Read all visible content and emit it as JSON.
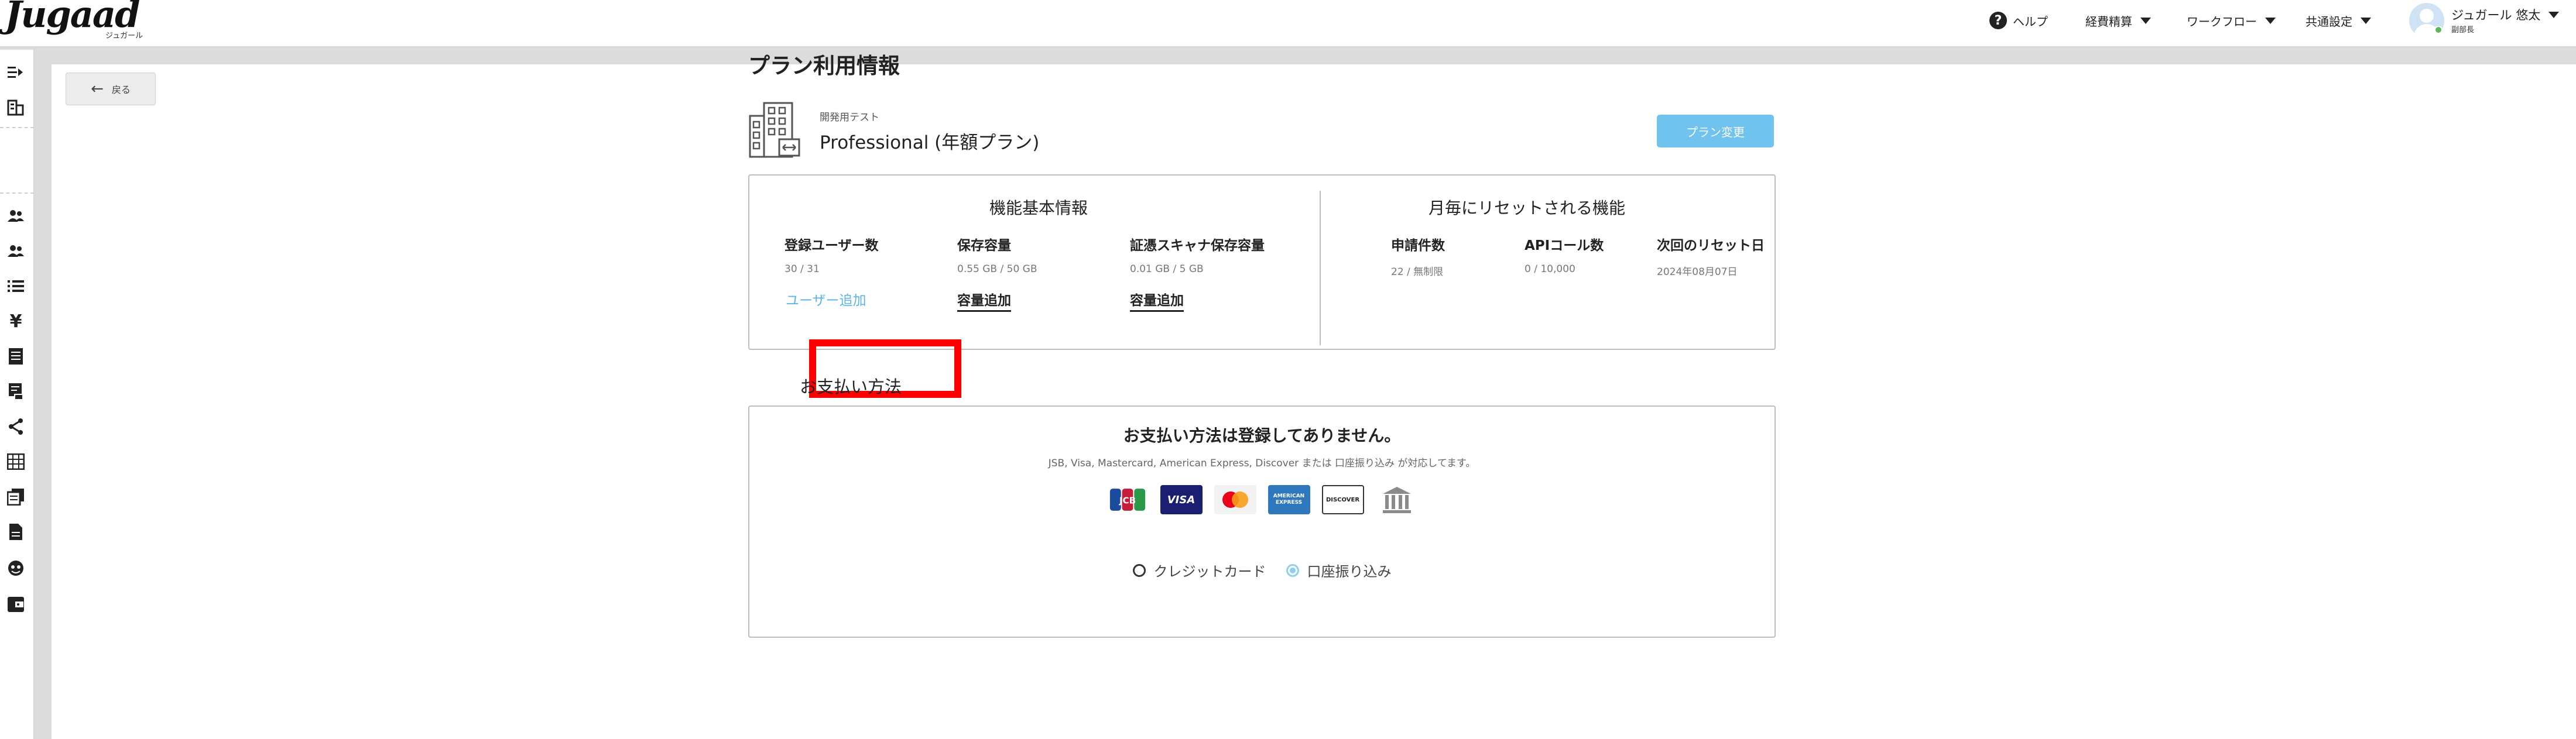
{
  "header": {
    "logo_text": "Jugaad",
    "logo_sub": "ジュガール",
    "help_label": "ヘルプ",
    "menu_expense": "経費精算",
    "menu_workflow": "ワークフロー",
    "menu_common": "共通設定",
    "user_name": "ジュガール 悠太",
    "user_role": "副部長"
  },
  "back_label": "戻る",
  "page_title": "プラン利用情報",
  "plan": {
    "company": "開発用テスト",
    "name": "Professional (年額プラン)",
    "change_button": "プラン変更"
  },
  "basic": {
    "title": "機能基本情報",
    "users_head": "登録ユーザー数",
    "users_value": "30 / 31",
    "users_link": "ユーザー追加",
    "storage_head": "保存容量",
    "storage_value": "0.55 GB / 50 GB",
    "storage_link": "容量追加",
    "scan_head": "証憑スキャナ保存容量",
    "scan_value": "0.01 GB / 5 GB",
    "scan_link": "容量追加"
  },
  "monthly": {
    "title": "月毎にリセットされる機能",
    "apps_head": "申請件数",
    "apps_value": "22 / 無制限",
    "api_head": "APIコール数",
    "api_value": "0 / 10,000",
    "reset_head": "次回のリセット日",
    "reset_value": "2024年08月07日"
  },
  "payment": {
    "title": "お支払い方法",
    "message": "お支払い方法は登録してありません。",
    "supported": "JSB, Visa, Mastercard, American Express, Discover または 口座振り込み が対応してます。",
    "card_logos": [
      {
        "label": "JCB",
        "color": "#1a4b9c"
      },
      {
        "label": "VISA",
        "color": "#1a1f71"
      },
      {
        "label": "MC",
        "color": "#ffffff"
      },
      {
        "label": "AMEX",
        "color": "#2e77bc"
      },
      {
        "label": "DISCOVER",
        "color": "#ffffff"
      },
      {
        "label": "BANK",
        "color": "#ffffff"
      }
    ],
    "option_credit": "クレジットカード",
    "option_bank": "口座振り込み",
    "selected": "口座振り込み"
  },
  "colors": {
    "accent": "#6fc3ee",
    "link": "#5bb4e8",
    "highlight": "#ff0000"
  }
}
